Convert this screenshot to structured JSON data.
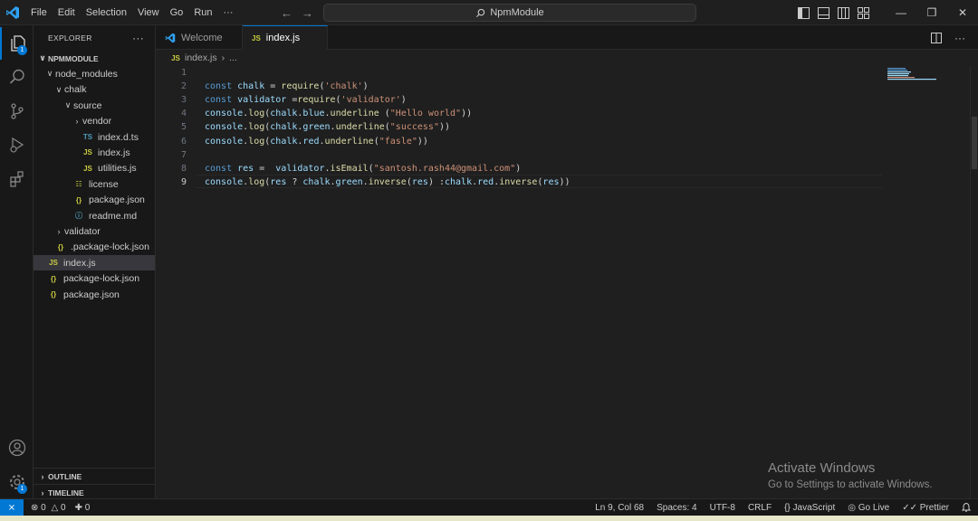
{
  "menu": [
    "File",
    "Edit",
    "Selection",
    "View",
    "Go",
    "Run",
    "···"
  ],
  "search": {
    "text": "NpmModule"
  },
  "window_controls": {
    "minimize": "—",
    "maximize": "❐",
    "close": "✕"
  },
  "activity_badges": {
    "explorer": "1",
    "manage": "1"
  },
  "explorer": {
    "title": "EXPLORER",
    "more": "···",
    "tree": [
      {
        "label": "NPMMODULE",
        "chevron": "∨",
        "icon": "",
        "icon_type": "",
        "bold": true
      },
      {
        "label": "node_modules",
        "chevron": "∨",
        "icon": "",
        "icon_type": ""
      },
      {
        "label": "chalk",
        "chevron": "∨",
        "icon": "",
        "icon_type": ""
      },
      {
        "label": "source",
        "chevron": "∨",
        "icon": "",
        "icon_type": ""
      },
      {
        "label": "vendor",
        "chevron": "›",
        "icon": "",
        "icon_type": ""
      },
      {
        "label": "index.d.ts",
        "chevron": "",
        "icon": "TS",
        "icon_type": "ts"
      },
      {
        "label": "index.js",
        "chevron": "",
        "icon": "JS",
        "icon_type": "js"
      },
      {
        "label": "utilities.js",
        "chevron": "",
        "icon": "JS",
        "icon_type": "js"
      },
      {
        "label": "license",
        "chevron": "",
        "icon": "☷",
        "icon_type": "lic"
      },
      {
        "label": "package.json",
        "chevron": "",
        "icon": "{}",
        "icon_type": "json"
      },
      {
        "label": "readme.md",
        "chevron": "",
        "icon": "ⓘ",
        "icon_type": "md"
      },
      {
        "label": "validator",
        "chevron": "›",
        "icon": "",
        "icon_type": ""
      },
      {
        "label": ".package-lock.json",
        "chevron": "",
        "icon": "{}",
        "icon_type": "json"
      },
      {
        "label": "index.js",
        "chevron": "",
        "icon": "JS",
        "icon_type": "js",
        "selected": true
      },
      {
        "label": "package-lock.json",
        "chevron": "",
        "icon": "{}",
        "icon_type": "json"
      },
      {
        "label": "package.json",
        "chevron": "",
        "icon": "{}",
        "icon_type": "json"
      }
    ],
    "outline": "OUTLINE",
    "timeline": "TIMELINE",
    "collapsed_chevron": "›"
  },
  "tabs": [
    {
      "label": "Welcome"
    },
    {
      "label": "index.js",
      "icon": "JS"
    }
  ],
  "breadcrumb": {
    "icon": "JS",
    "file": "index.js",
    "sep": "›",
    "more": "..."
  },
  "editor": {
    "line_numbers": [
      "1",
      "2",
      "3",
      "4",
      "5",
      "6",
      "7",
      "8",
      "9"
    ],
    "lines": [
      [],
      [
        {
          "t": "const ",
          "c": "k"
        },
        {
          "t": "chalk",
          "c": "v"
        },
        {
          "t": " = ",
          "c": "p"
        },
        {
          "t": "require",
          "c": "f"
        },
        {
          "t": "(",
          "c": "p"
        },
        {
          "t": "'chalk'",
          "c": "s"
        },
        {
          "t": ")",
          "c": "p"
        }
      ],
      [
        {
          "t": "const ",
          "c": "k"
        },
        {
          "t": "validator",
          "c": "v"
        },
        {
          "t": " =",
          "c": "p"
        },
        {
          "t": "require",
          "c": "f"
        },
        {
          "t": "(",
          "c": "p"
        },
        {
          "t": "'validator'",
          "c": "s"
        },
        {
          "t": ")",
          "c": "p"
        }
      ],
      [
        {
          "t": "console",
          "c": "v"
        },
        {
          "t": ".",
          "c": "p"
        },
        {
          "t": "log",
          "c": "f"
        },
        {
          "t": "(",
          "c": "p"
        },
        {
          "t": "chalk",
          "c": "v"
        },
        {
          "t": ".",
          "c": "p"
        },
        {
          "t": "blue",
          "c": "v"
        },
        {
          "t": ".",
          "c": "p"
        },
        {
          "t": "underline",
          "c": "f"
        },
        {
          "t": " (",
          "c": "p"
        },
        {
          "t": "\"Hello world\"",
          "c": "s"
        },
        {
          "t": "))",
          "c": "p"
        }
      ],
      [
        {
          "t": "console",
          "c": "v"
        },
        {
          "t": ".",
          "c": "p"
        },
        {
          "t": "log",
          "c": "f"
        },
        {
          "t": "(",
          "c": "p"
        },
        {
          "t": "chalk",
          "c": "v"
        },
        {
          "t": ".",
          "c": "p"
        },
        {
          "t": "green",
          "c": "v"
        },
        {
          "t": ".",
          "c": "p"
        },
        {
          "t": "underline",
          "c": "f"
        },
        {
          "t": "(",
          "c": "p"
        },
        {
          "t": "\"success\"",
          "c": "s"
        },
        {
          "t": "))",
          "c": "p"
        }
      ],
      [
        {
          "t": "console",
          "c": "v"
        },
        {
          "t": ".",
          "c": "p"
        },
        {
          "t": "log",
          "c": "f"
        },
        {
          "t": "(",
          "c": "p"
        },
        {
          "t": "chalk",
          "c": "v"
        },
        {
          "t": ".",
          "c": "p"
        },
        {
          "t": "red",
          "c": "v"
        },
        {
          "t": ".",
          "c": "p"
        },
        {
          "t": "underline",
          "c": "f"
        },
        {
          "t": "(",
          "c": "p"
        },
        {
          "t": "\"fasle\"",
          "c": "s"
        },
        {
          "t": "))",
          "c": "p"
        }
      ],
      [],
      [
        {
          "t": "const ",
          "c": "k"
        },
        {
          "t": "res",
          "c": "v"
        },
        {
          "t": " =  ",
          "c": "p"
        },
        {
          "t": "validator",
          "c": "v"
        },
        {
          "t": ".",
          "c": "p"
        },
        {
          "t": "isEmail",
          "c": "f"
        },
        {
          "t": "(",
          "c": "p"
        },
        {
          "t": "\"santosh.rash44@gmail.com\"",
          "c": "s"
        },
        {
          "t": ")",
          "c": "p"
        }
      ],
      [
        {
          "t": "console",
          "c": "v"
        },
        {
          "t": ".",
          "c": "p"
        },
        {
          "t": "log",
          "c": "f"
        },
        {
          "t": "(",
          "c": "p"
        },
        {
          "t": "res",
          "c": "v"
        },
        {
          "t": " ? ",
          "c": "p"
        },
        {
          "t": "chalk",
          "c": "v"
        },
        {
          "t": ".",
          "c": "p"
        },
        {
          "t": "green",
          "c": "v"
        },
        {
          "t": ".",
          "c": "p"
        },
        {
          "t": "inverse",
          "c": "f"
        },
        {
          "t": "(",
          "c": "p"
        },
        {
          "t": "res",
          "c": "v"
        },
        {
          "t": ") :",
          "c": "p"
        },
        {
          "t": "chalk",
          "c": "v"
        },
        {
          "t": ".",
          "c": "p"
        },
        {
          "t": "red",
          "c": "v"
        },
        {
          "t": ".",
          "c": "p"
        },
        {
          "t": "inverse",
          "c": "f"
        },
        {
          "t": "(",
          "c": "p"
        },
        {
          "t": "res",
          "c": "v"
        },
        {
          "t": "))",
          "c": "p"
        }
      ]
    ]
  },
  "watermark": {
    "title": "Activate Windows",
    "subtitle": "Go to Settings to activate Windows."
  },
  "status": {
    "remote": "⨯",
    "errors": "0",
    "warnings": "0",
    "ports": "0",
    "position": "Ln 9, Col 68",
    "spaces": "Spaces: 4",
    "encoding": "UTF-8",
    "eol": "CRLF",
    "language": "JavaScript",
    "golive": "Go Live",
    "prettier": "Prettier",
    "bell": "🔔"
  },
  "colors": {
    "accent": "#0078d4",
    "bg": "#1f1f1f",
    "sidebar": "#181818"
  }
}
